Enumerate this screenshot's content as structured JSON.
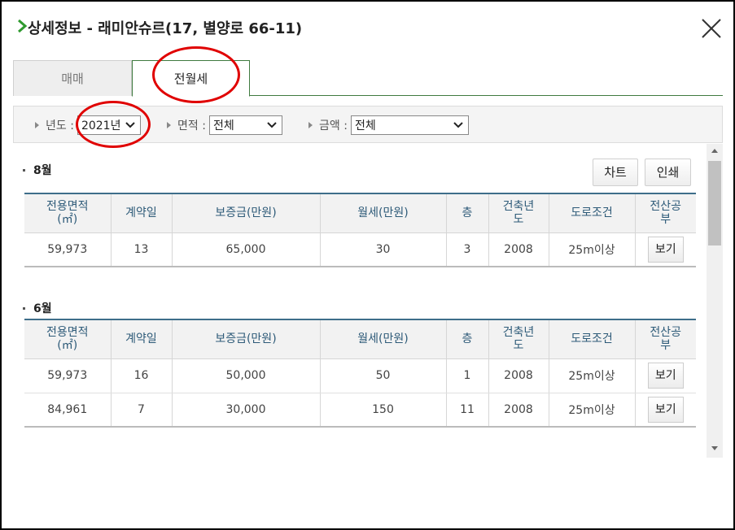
{
  "header": {
    "title": "상세정보 - 래미안슈르(17, 별양로 66-11)"
  },
  "tabs": [
    {
      "label": "매매",
      "active": false
    },
    {
      "label": "전월세",
      "active": true
    }
  ],
  "filters": {
    "year": {
      "label": "년도 :",
      "value": "2021년"
    },
    "area": {
      "label": "면적 :",
      "value": "전체"
    },
    "amount": {
      "label": "금액 :",
      "value": "전체"
    }
  },
  "buttons": {
    "chart": "차트",
    "print": "인쇄"
  },
  "columns": [
    "전용면적\n(㎡)",
    "계약일",
    "보증금(만원)",
    "월세(만원)",
    "층",
    "건축년\n도",
    "도로조건",
    "전산공\n부"
  ],
  "sections": [
    {
      "month": "8월",
      "rows": [
        {
          "area": "59,973",
          "day": "13",
          "deposit": "65,000",
          "rent": "30",
          "floor": "3",
          "built": "2008",
          "road": "25m이상",
          "doc": "보기"
        }
      ]
    },
    {
      "month": "6월",
      "rows": [
        {
          "area": "59,973",
          "day": "16",
          "deposit": "50,000",
          "rent": "50",
          "floor": "1",
          "built": "2008",
          "road": "25m이상",
          "doc": "보기"
        },
        {
          "area": "84,961",
          "day": "7",
          "deposit": "30,000",
          "rent": "150",
          "floor": "11",
          "built": "2008",
          "road": "25m이상",
          "doc": "보기"
        }
      ]
    }
  ],
  "colors": {
    "accent": "#3f7a3f",
    "tableHeaderText": "#2d5a78",
    "annotation": "#e00000"
  },
  "icons": {
    "header": "chevron-right-icon",
    "close": "close-icon",
    "select": "chevron-down-icon"
  }
}
